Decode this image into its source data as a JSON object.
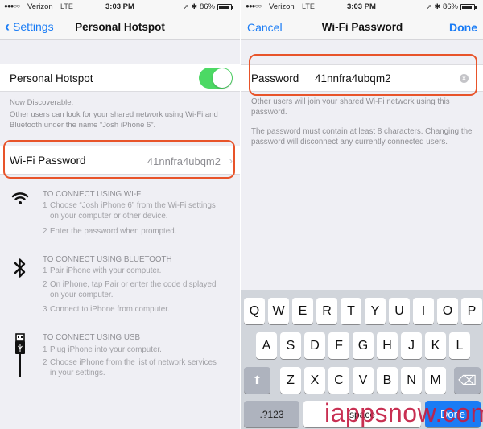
{
  "status_bar": {
    "signal": "●●●○○",
    "carrier": "Verizon",
    "network": "LTE",
    "time": "3:03 PM",
    "location_glyph": "➚",
    "bluetooth_glyph": "✱",
    "battery": "86%",
    "battery_level": 0.86
  },
  "left_screen": {
    "nav": {
      "back_label": "Settings",
      "title": "Personal Hotspot"
    },
    "hotspot": {
      "label": "Personal Hotspot",
      "enabled": true,
      "toggle_color": "#4cd964"
    },
    "discoverable": "Now Discoverable.",
    "discoverable_desc": "Other users can look for your shared network using Wi-Fi and Bluetooth under the name “Josh iPhone 6”.",
    "wifi_password": {
      "label": "Wi-Fi Password",
      "value": "41nnfra4ubqm2"
    },
    "sections": [
      {
        "icon": "wifi-icon",
        "heading": "TO CONNECT USING WI-FI",
        "steps": [
          {
            "num": "1",
            "text": "Choose “Josh iPhone 6” from the Wi-Fi settings",
            "cont": "on your computer or other device."
          },
          {
            "num": "2",
            "text": "Enter the password when prompted.",
            "cont": ""
          }
        ]
      },
      {
        "icon": "bluetooth-icon",
        "heading": "TO CONNECT USING BLUETOOTH",
        "steps": [
          {
            "num": "1",
            "text": "Pair iPhone with your computer.",
            "cont": ""
          },
          {
            "num": "2",
            "text": "On iPhone, tap Pair or enter the code displayed",
            "cont": "on your computer."
          },
          {
            "num": "3",
            "text": "Connect to iPhone from computer.",
            "cont": ""
          }
        ]
      },
      {
        "icon": "usb-icon",
        "heading": "TO CONNECT USING USB",
        "steps": [
          {
            "num": "1",
            "text": "Plug iPhone into your computer.",
            "cont": ""
          },
          {
            "num": "2",
            "text": "Choose iPhone from the list of network services",
            "cont": "in your settings."
          }
        ]
      }
    ]
  },
  "right_screen": {
    "nav": {
      "cancel_label": "Cancel",
      "title": "Wi-Fi Password",
      "done_label": "Done"
    },
    "password_field": {
      "label": "Password",
      "value": "41nnfra4ubqm2",
      "clear_glyph": "×"
    },
    "note1": "Other users will join your shared Wi-Fi network using this password.",
    "note2": "The password must contain at least 8 characters. Changing the password will disconnect any currently connected users.",
    "keyboard": {
      "row1": [
        "Q",
        "W",
        "E",
        "R",
        "T",
        "Y",
        "U",
        "I",
        "O",
        "P"
      ],
      "row2": [
        "A",
        "S",
        "D",
        "F",
        "G",
        "H",
        "J",
        "K",
        "L"
      ],
      "row3": [
        "Z",
        "X",
        "C",
        "V",
        "B",
        "N",
        "M"
      ],
      "shift_glyph": "⬆",
      "delete_glyph": "⌫",
      "numbers_label": ".?123",
      "space_label": "space",
      "return_label": "Done"
    }
  },
  "highlight_color": "#e8542a",
  "watermark": "iappsnow.com",
  "accent_color": "#1a7cf5"
}
